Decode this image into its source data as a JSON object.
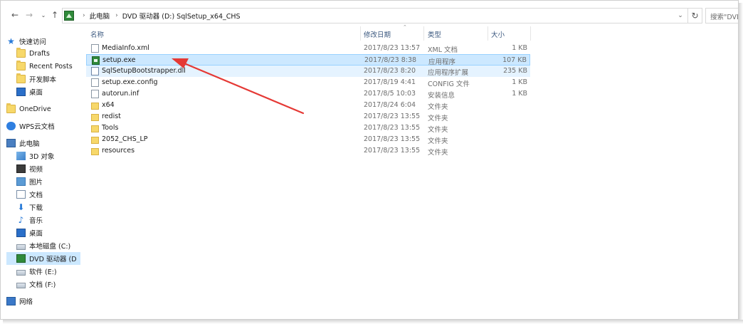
{
  "address": {
    "crumbs": [
      "此电脑",
      "DVD 驱动器 (D:) SqlSetup_x64_CHS"
    ],
    "search_placeholder": "搜索\"DVD 驱动器 (D:)"
  },
  "sidebar": {
    "items": [
      {
        "label": "快速访问",
        "icon": "star-icon"
      },
      {
        "label": "Drafts",
        "icon": "folder-icon"
      },
      {
        "label": "Recent Posts",
        "icon": "folder-icon"
      },
      {
        "label": "开发脚本",
        "icon": "folder-icon"
      },
      {
        "label": "桌面",
        "icon": "desktop-icon"
      },
      {
        "label": "OneDrive",
        "icon": "folder-icon"
      },
      {
        "label": "WPS云文档",
        "icon": "cloud-icon"
      },
      {
        "label": "此电脑",
        "icon": "computer-icon"
      },
      {
        "label": "3D 对象",
        "icon": "3d-objects-icon"
      },
      {
        "label": "视频",
        "icon": "video-icon"
      },
      {
        "label": "图片",
        "icon": "pictures-icon"
      },
      {
        "label": "文档",
        "icon": "documents-icon"
      },
      {
        "label": "下载",
        "icon": "download-icon"
      },
      {
        "label": "音乐",
        "icon": "music-icon"
      },
      {
        "label": "桌面",
        "icon": "desktop-icon"
      },
      {
        "label": "本地磁盘 (C:)",
        "icon": "drive-icon"
      },
      {
        "label": "DVD 驱动器 (D",
        "icon": "dvd-drive-icon"
      },
      {
        "label": "软件 (E:)",
        "icon": "drive-icon"
      },
      {
        "label": "文档 (F:)",
        "icon": "drive-icon"
      },
      {
        "label": "网络",
        "icon": "network-icon"
      }
    ]
  },
  "columns": {
    "name": "名称",
    "date": "修改日期",
    "type": "类型",
    "size": "大小"
  },
  "files": [
    {
      "name": "MediaInfo.xml",
      "date": "2017/8/23 13:57",
      "type": "XML 文档",
      "size": "1 KB",
      "icon": "xml-file-icon"
    },
    {
      "name": "setup.exe",
      "date": "2017/8/23 8:38",
      "type": "应用程序",
      "size": "107 KB",
      "icon": "exe-file-icon"
    },
    {
      "name": "SqlSetupBootstrapper.dll",
      "date": "2017/8/23 8:20",
      "type": "应用程序扩展",
      "size": "235 KB",
      "icon": "dll-file-icon"
    },
    {
      "name": "setup.exe.config",
      "date": "2017/8/19 4:41",
      "type": "CONFIG 文件",
      "size": "1 KB",
      "icon": "config-file-icon"
    },
    {
      "name": "autorun.inf",
      "date": "2017/8/5 10:03",
      "type": "安装信息",
      "size": "1 KB",
      "icon": "inf-file-icon"
    },
    {
      "name": "x64",
      "date": "2017/8/24 6:04",
      "type": "文件夹",
      "size": "",
      "icon": "folder-icon"
    },
    {
      "name": "redist",
      "date": "2017/8/23 13:55",
      "type": "文件夹",
      "size": "",
      "icon": "folder-icon"
    },
    {
      "name": "Tools",
      "date": "2017/8/23 13:55",
      "type": "文件夹",
      "size": "",
      "icon": "folder-icon"
    },
    {
      "name": "2052_CHS_LP",
      "date": "2017/8/23 13:55",
      "type": "文件夹",
      "size": "",
      "icon": "folder-icon"
    },
    {
      "name": "resources",
      "date": "2017/8/23 13:55",
      "type": "文件夹",
      "size": "",
      "icon": "folder-icon"
    }
  ],
  "colors": {
    "selection": "#cce8ff",
    "hover": "#e5f3ff",
    "annotation_arrow": "#e53935"
  }
}
